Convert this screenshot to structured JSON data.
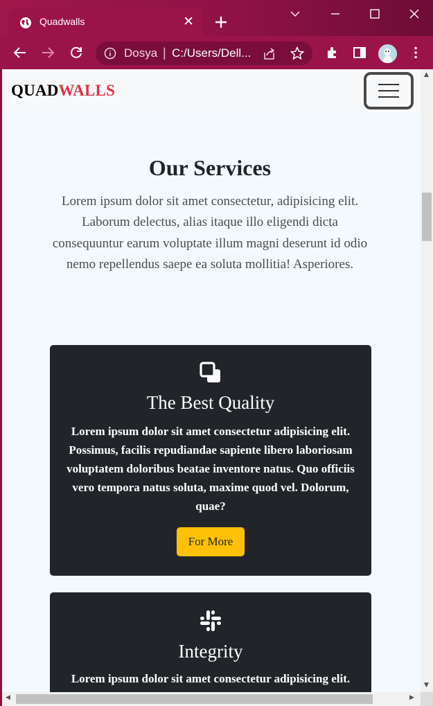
{
  "browser": {
    "tab_title": "Quadwalls",
    "close_glyph": "✕",
    "omnibox_scheme": "Dosya",
    "omnibox_separator": "|",
    "omnibox_url": "C:/Users/Dell...",
    "theme_color": "#9b1449"
  },
  "site": {
    "brand_part1": "QUAD",
    "brand_part2": "WALLS",
    "brand_accent": "#dc3545"
  },
  "services": {
    "title": "Our Services",
    "description": "Lorem ipsum dolor sit amet consectetur, adipisicing elit. Laborum delectus, alias itaque illo eligendi dicta consequuntur earum voluptate illum magni deserunt id odio nemo repellendus saepe ea soluta mollitia! Asperiores.",
    "cards": [
      {
        "icon": "copy-icon",
        "title": "The Best Quality",
        "text": "Lorem ipsum dolor sit amet consectetur adipisicing elit. Possimus, facilis repudiandae sapiente libero laboriosam voluptatem doloribus beatae inventore natus. Quo officiis vero tempora natus soluta, maxime quod vel. Dolorum, quae?",
        "button": "For More"
      },
      {
        "icon": "slack-icon",
        "title": "Integrity",
        "text": "Lorem ipsum dolor sit amet consectetur adipisicing elit."
      }
    ],
    "button_color": "#ffc107",
    "card_color": "#212529"
  }
}
